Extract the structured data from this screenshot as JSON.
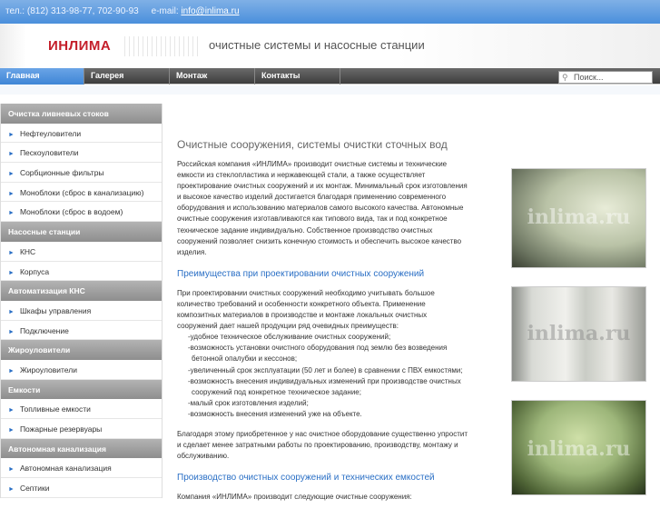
{
  "topbar": {
    "phone": "тел.: (812) 313-98-77, 702-90-93",
    "email_label": "e-mail:",
    "email": "info@inlima.ru"
  },
  "banner": {
    "logo": "ИНЛИМА",
    "tagline": "очистные системы и насосные станции"
  },
  "nav": {
    "tabs": [
      "Главная",
      "Галерея",
      "Монтаж",
      "Контакты"
    ],
    "search_placeholder": "Поиск..."
  },
  "sidebar": [
    {
      "header": "Очистка ливневых стоков",
      "items": [
        "Нефтеуловители",
        "Пескоуловители",
        "Сорбционные фильтры",
        "Моноблоки (сброс в канализацию)",
        "Моноблоки (сброс в водоем)"
      ]
    },
    {
      "header": "Насосные станции",
      "items": [
        "КНС",
        "Корпуса"
      ]
    },
    {
      "header": "Автоматизация КНС",
      "items": [
        "Шкафы управления",
        "Подключение"
      ]
    },
    {
      "header": "Жироуловители",
      "items": [
        "Жироуловители"
      ]
    },
    {
      "header": "Емкости",
      "items": [
        "Топливные емкости",
        "Пожарные резервуары"
      ]
    },
    {
      "header": "Автономная канализация",
      "items": [
        "Автономная канализация",
        "Септики"
      ]
    }
  ],
  "main": {
    "title": "Очистные сооружения, системы очистки сточных вод",
    "intro": "Российская компания «ИНЛИМА» производит очистные системы и технические емкости из стеклопластика и нержавеющей стали, а также осуществляет проектирование очистных сооружений и их монтаж. Минимальный срок изготовления и высокое качество изделий достигается благодаря применению современного оборудования и использованию материалов самого высокого качества. Автономные очистные сооружения изготавливаются как типового вида, так и под конкретное техническое задание индивидуально. Собственное производство очистных сооружений позволяет снизить конечную стоимость и обеспечить высокое качество изделия.",
    "h2_advantages": "Преимущества при проектировании очистных сооружений",
    "adv_intro": "При проектировании очистных сооружений необходимо учитывать большое количество требований и особенности конкретного объекта. Применение композитных материалов в производстве и монтаже локальных очистных сооружений дает нашей продукции ряд очевидных преимуществ:",
    "advantages": [
      "-удобное техническое обслуживание очистных сооружений;",
      "-возможность установки очистного оборудования под землю без возведения бетонной опалубки и кессонов;",
      "-увеличенный срок эксплуатации (50 лет и более) в сравнении с ПВХ емкостями;",
      "-возможность внесения индивидуальных изменений при производстве очистных сооружений под конкретное техническое задание;",
      "-малый срок изготовления изделий;",
      "-возможность внесения изменений уже на объекте."
    ],
    "conclusion": "Благодаря этому приобретенное у нас очистное оборудование существенно упростит и сделает менее затратными работы по проектированию, производству, монтажу и обслуживанию.",
    "h2_production": "Производство очистных сооружений и технических емкостей",
    "production_intro": "Компания «ИНЛИМА» производит следующие очистные сооружения:"
  },
  "photos": {
    "watermark": "inlima.ru"
  }
}
